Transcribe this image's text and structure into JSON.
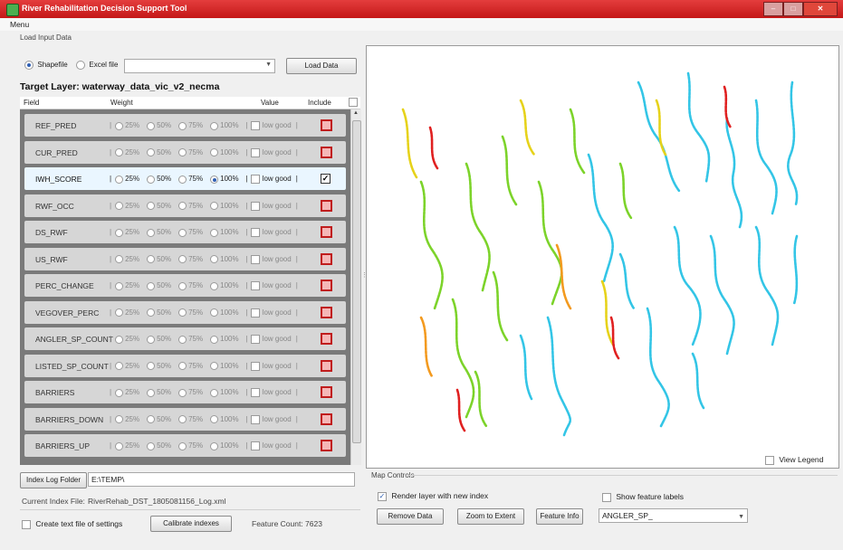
{
  "window": {
    "title": "River Rehabilitation Decision Support Tool"
  },
  "menu": {
    "label": "Menu"
  },
  "load_input": {
    "group_label": "Load Input Data",
    "shapefile_label": "Shapefile",
    "excel_label": "Excel file",
    "file_value": "",
    "load_button": "Load Data"
  },
  "target_layer": {
    "label": "Target Layer: waterway_data_vic_v2_necma"
  },
  "table_header": {
    "field": "Field",
    "weight": "Weight",
    "value": "Value",
    "include": "Include"
  },
  "weights": [
    "25%",
    "50%",
    "75%",
    "100%"
  ],
  "value_label": "low good",
  "rows": [
    {
      "field": "REF_PRED",
      "active": false
    },
    {
      "field": "CUR_PRED",
      "active": false
    },
    {
      "field": "IWH_SCORE",
      "active": true
    },
    {
      "field": "RWF_OCC",
      "active": false
    },
    {
      "field": "DS_RWF",
      "active": false
    },
    {
      "field": "US_RWF",
      "active": false
    },
    {
      "field": "PERC_CHANGE",
      "active": false
    },
    {
      "field": "VEGOVER_PERC",
      "active": false
    },
    {
      "field": "ANGLER_SP_COUNT",
      "active": false
    },
    {
      "field": "LISTED_SP_COUNT",
      "active": false
    },
    {
      "field": "BARRIERS",
      "active": false
    },
    {
      "field": "BARRIERS_DOWN",
      "active": false
    },
    {
      "field": "BARRIERS_UP",
      "active": false
    }
  ],
  "bottom_left": {
    "index_log_button": "Index Log Folder",
    "index_log_path": "E:\\TEMP\\",
    "current_index_label": "Current Index File:",
    "current_index_value": "RiverRehab_DST_1805081156_Log.xml",
    "create_text_label": "Create text file of settings",
    "calibrate_button": "Calibrate indexes",
    "feature_count": "Feature Count: 7623"
  },
  "map": {
    "view_legend_label": "View Legend"
  },
  "map_controls": {
    "group_label": "Map Controls",
    "render_label": "Render layer with new index",
    "show_labels": "Show feature labels",
    "remove_button": "Remove Data",
    "zoom_button": "Zoom to Extent",
    "feature_info_button": "Feature Info",
    "label_field_value": "ANGLER_SP_"
  },
  "colors": {
    "titlebar": "#d42a2a",
    "river_cyan": "#33c5e6",
    "river_green": "#7cd32a",
    "river_yellow": "#e6d21a",
    "river_orange": "#f39a1f",
    "river_red": "#e02020",
    "include_red": "#c01d1d"
  }
}
